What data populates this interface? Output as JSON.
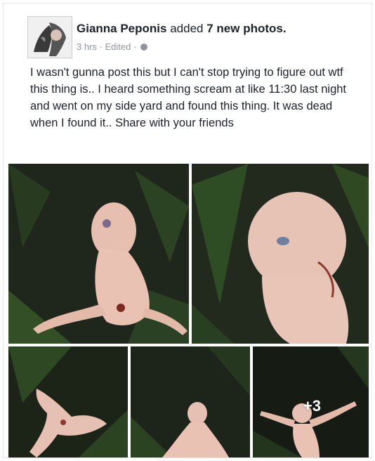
{
  "post": {
    "author": "Gianna Peponis",
    "action": "added",
    "count": "7 new photos.",
    "time": "3 hrs",
    "edited": "Edited",
    "separator": "·",
    "body": "I wasn't gunna post this but I can't stop trying to figure out wtf this thing is.. I heard something scream at like 11:30 last night and went on my side yard and found this thing. It was dead when I found it.. Share with your friends"
  },
  "photos": {
    "more_count": "+3"
  },
  "colors": {
    "text": "#1d2129",
    "meta": "#90949c",
    "grass_dark": "#1a1f17",
    "grass": "#3d6b2c",
    "creature": "#e9c2b4"
  }
}
